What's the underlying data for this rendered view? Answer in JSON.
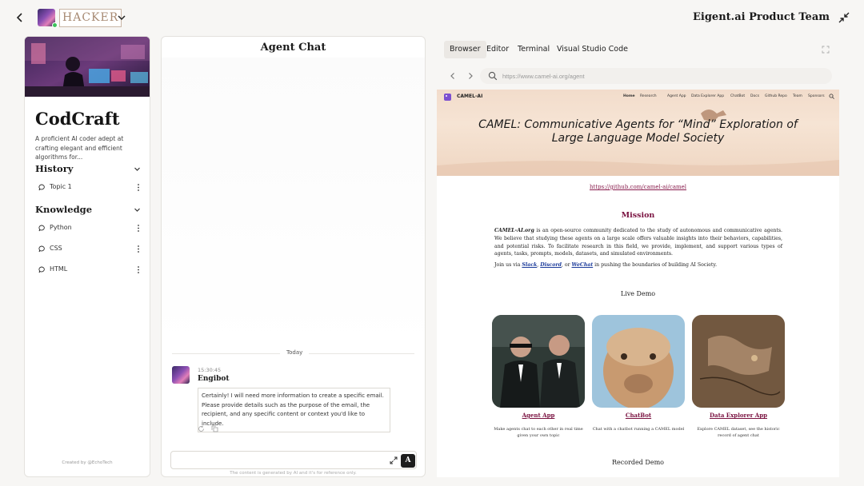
{
  "topbar": {
    "agent_name": "HACKER",
    "team_title": "Eigent.ai Product Team"
  },
  "profile": {
    "name": "CodCraft",
    "description": "A proficient AI coder adept at crafting elegant and efficient algorithms for...",
    "history_title": "History",
    "history_items": [
      {
        "label": "Topic 1"
      }
    ],
    "knowledge_title": "Knowledge",
    "knowledge_items": [
      {
        "label": "Python"
      },
      {
        "label": "CSS"
      },
      {
        "label": "HTML"
      }
    ],
    "created_by": "Created by @EchoTech"
  },
  "chat": {
    "title": "Agent Chat",
    "day_label": "Today",
    "message": {
      "time": "15:30:45",
      "sender": "Engibot",
      "text": "Certainly! I will need more information to create a specific email. Please provide details such as the purpose of the email, the recipient, and any specific content or context you'd like to include."
    },
    "input_placeholder": "",
    "send_glyph": "A",
    "disclaimer": "The content is generated by AI and it's for reference only."
  },
  "workspace": {
    "tabs": [
      {
        "label": "Browser",
        "active": true
      },
      {
        "label": "Editor",
        "active": false
      },
      {
        "label": "Terminal",
        "active": false
      },
      {
        "label": "Visual Studio Code",
        "active": false
      }
    ],
    "url": "https://www.camel-ai.org/agent"
  },
  "site": {
    "logo": "CAMEL-AI",
    "nav": [
      "Home",
      "Research",
      "Agent App",
      "Data Explorer App",
      "ChatBot",
      "Docs",
      "Github Repo",
      "Team",
      "Sponsors"
    ],
    "hero_title_line1": "CAMEL:  Communicative Agents for “Mind” Exploration of",
    "hero_title_line2": "Large Language Model Society",
    "github_link": "https://github.com/camel-ai/camel",
    "mission_heading": "Mission",
    "mission_org": "CAMEL-AI.org",
    "mission_body": " is an open-source community dedicated to the study of autonomous and communicative agents. We believe that studying these agents on a large scale offers valuable insights into their behaviors, capabilities, and potential risks. To facilitate research in this field, we provide, implement, and support various types of agents, tasks, prompts, models, datasets, and simulated environments.",
    "join_prefix": "Join us via ",
    "join_links": [
      "Slack",
      "Discord",
      "WeChat"
    ],
    "join_sep1": ", ",
    "join_sep2": ", or ",
    "join_suffix": " in pushing the boundaries of building AI Society.",
    "live_demo": "Live Demo",
    "cards": [
      {
        "title": "Agent App",
        "desc": "Make agents chat to each other in real time given your own topic"
      },
      {
        "title": "ChatBot",
        "desc": "Chat with a chatbot running a CAMEL model"
      },
      {
        "title": "Data Explorer App",
        "desc": "Explore CAMEL dataset, see the historic record of agent chat"
      }
    ],
    "recorded_demo": "Recorded  Demo"
  }
}
